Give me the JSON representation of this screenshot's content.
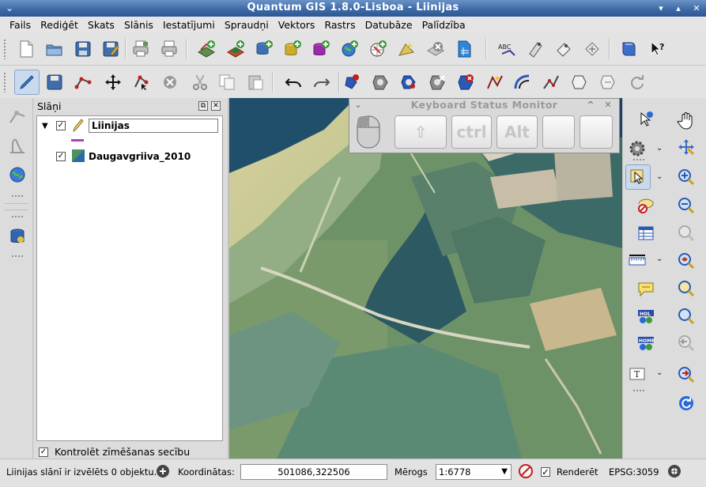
{
  "window": {
    "title": "Quantum GIS 1.8.0-Lisboa - Liinijas",
    "menu_glyph": "⌄",
    "min_glyph": "▾",
    "max_glyph": "▴",
    "close_glyph": "✕"
  },
  "menubar": [
    "Fails",
    "Rediģēt",
    "Skats",
    "Slānis",
    "Iestatījumi",
    "Spraudņi",
    "Vektors",
    "Rastrs",
    "Datubāze",
    "Palīdzība"
  ],
  "toolbar1": {
    "icons": [
      "new-project-icon",
      "open-project-icon",
      "save-project-icon",
      "save-as-icon",
      "print-composer-icon",
      "print-icon",
      "add-vector-layer-icon",
      "add-raster-layer-icon",
      "add-postgis-layer-icon",
      "add-spatialite-layer-icon",
      "add-mssql-layer-icon",
      "add-wms-layer-icon",
      "add-wfs-layer-icon",
      "new-shapefile-icon",
      "remove-layer-icon",
      "add-delimited-text-icon",
      "spell-label-icon",
      "plugin-a-icon",
      "plugin-b-icon",
      "plugin-c-icon",
      "help-book-icon",
      "whats-this-icon"
    ],
    "abc_text": "ABC"
  },
  "toolbar2": {
    "icons": [
      "toggle-editing-icon",
      "save-edits-icon",
      "add-feature-icon",
      "move-feature-icon",
      "node-tool-icon",
      "delete-selected-icon",
      "cut-features-icon",
      "copy-features-icon",
      "paste-features-icon",
      "undo-icon",
      "redo-icon",
      "simplify-feature-icon",
      "add-ring-icon",
      "add-part-icon",
      "delete-ring-icon",
      "delete-part-icon",
      "reshape-features-icon",
      "offset-curve-icon",
      "split-features-icon",
      "merge-features-icon",
      "merge-attributes-icon",
      "rotate-point-symbols-icon"
    ]
  },
  "layers_panel": {
    "title": "Slāņi",
    "layers": [
      {
        "name": "Liinijas",
        "checked": true,
        "expanded": true,
        "legend_color": "#b03cc0"
      },
      {
        "name": "Daugavgriiva_2010",
        "checked": true,
        "expanded": false
      }
    ],
    "checked_glyph": "✓",
    "expand_glyph": "▼",
    "control_rendering_order": {
      "label": "Kontrolēt zīmēšanas secību",
      "checked": true
    }
  },
  "keyboard_status_monitor": {
    "title": "Keyboard Status Monitor",
    "keys": [
      "",
      "ctrl",
      "Alt",
      "",
      ""
    ],
    "shift_glyph": "⇧",
    "collapse_glyph": "^",
    "close_glyph": "✕"
  },
  "left_toolbar": {
    "icons": [
      "georeferencer-icon",
      "raster-histogram-icon",
      "earth-plugin-icon",
      "db-manager-icon"
    ]
  },
  "right_toolbar": {
    "icons": [
      "identify-icon",
      "pan-icon",
      "settings-gear-icon",
      "zoom-pan-icon",
      "select-feature-icon",
      "zoom-in-icon",
      "deselect-icon",
      "zoom-out-icon",
      "attribute-table-icon",
      "zoom-full-icon",
      "measure-icon",
      "zoom-layer-icon",
      "map-tips-icon",
      "zoom-selection-icon",
      "bookmark-new-icon",
      "zoom-native-icon",
      "bookmarks-icon",
      "zoom-last-icon",
      "text-annotation-icon",
      "zoom-next-icon",
      "refresh-icon"
    ],
    "t_label": "T",
    "hol_label": "HOL",
    "home_label": "HOME"
  },
  "statusbar": {
    "message": "Liinijas slānī ir izvēlēts 0 objektu.",
    "coords_label": "Koordinātas:",
    "coords_value": "501086,322506",
    "scale_label": "Mērogs",
    "scale_value": "1:6778",
    "render_label": "Renderēt",
    "render_checked": true,
    "crs": "EPSG:3059"
  }
}
